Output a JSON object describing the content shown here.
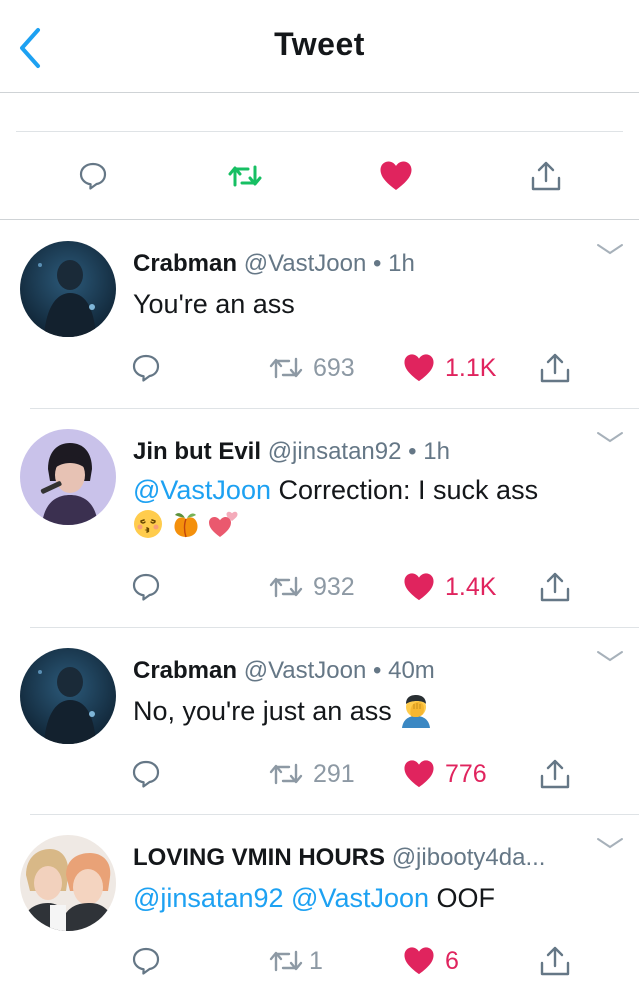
{
  "header": {
    "title": "Tweet"
  },
  "main_actions": {
    "reply_icon": "reply-icon",
    "retweet_icon": "retweet-icon",
    "like_icon": "heart-icon",
    "share_icon": "share-icon",
    "colors": {
      "retweet_active": "#17bf63",
      "like_active": "#e0245e",
      "icon_gray": "#657786"
    }
  },
  "replies": [
    {
      "name": "Crabman",
      "handle": "@VastJoon",
      "dot": "•",
      "time": "1h",
      "text": "You're an ass",
      "mentions": [],
      "emojis": [],
      "retweets": "693",
      "likes": "1.1K"
    },
    {
      "name": "Jin but Evil",
      "handle": "@jinsatan92",
      "dot": "•",
      "time": "1h",
      "mentions": [
        "@VastJoon"
      ],
      "text": " Correction: I suck ass",
      "emojis": [
        "kissing-face-emoji",
        "peach-emoji",
        "two-hearts-emoji"
      ],
      "retweets": "932",
      "likes": "1.4K"
    },
    {
      "name": "Crabman",
      "handle": "@VastJoon",
      "dot": "•",
      "time": "40m",
      "text": "No, you're just an ass ",
      "mentions": [],
      "emojis": [
        "facepalm-emoji"
      ],
      "retweets": "291",
      "likes": "776"
    },
    {
      "name": "LOVING VMIN HOURS",
      "handle": "@jibooty4da...",
      "mentions": [
        "@jinsatan92",
        "@VastJoon"
      ],
      "text": " OOF",
      "emojis": [],
      "retweets": "1",
      "likes": "6"
    }
  ]
}
